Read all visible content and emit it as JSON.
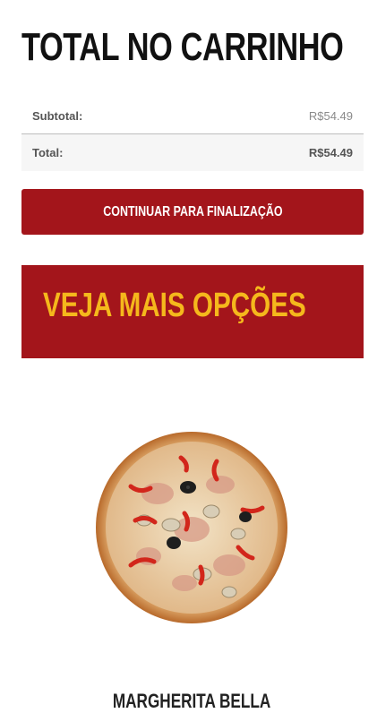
{
  "cart_totals": {
    "title": "TOTAL NO CARRINHO",
    "subtotal_label": "Subtotal:",
    "subtotal_value": "R$54.49",
    "total_label": "Total:",
    "total_value": "R$54.49"
  },
  "checkout_button": {
    "label": "CONTINUAR PARA FINALIZAÇÃO"
  },
  "more_options": {
    "label": "VEJA MAIS OPÇÕES"
  },
  "product": {
    "name": "MARGHERITA BELLA",
    "image": "pizza-image"
  },
  "colors": {
    "brand_red": "#a3151b",
    "accent_yellow": "#f5b81c",
    "title_text": "#111111"
  }
}
